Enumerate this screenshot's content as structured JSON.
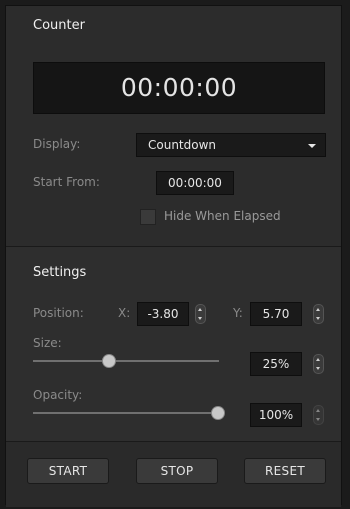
{
  "counter": {
    "title": "Counter",
    "time": "00:00:00",
    "display_label": "Display:",
    "display_value": "Countdown",
    "start_from_label": "Start From:",
    "start_from_value": "00:00:00",
    "hide_when_elapsed_label": "Hide When Elapsed",
    "hide_when_elapsed_checked": false
  },
  "settings": {
    "title": "Settings",
    "position_label": "Position:",
    "x_label": "X:",
    "x_value": "-3.80",
    "y_label": "Y:",
    "y_value": "5.70",
    "size_label": "Size:",
    "size_value": "25%",
    "size_fraction": 0.25,
    "opacity_label": "Opacity:",
    "opacity_value": "100%",
    "opacity_fraction": 1.0
  },
  "controls": {
    "start_label": "START",
    "stop_label": "STOP",
    "reset_label": "RESET"
  },
  "icons": [
    "chevron-down-icon",
    "stepper-arrows-icon",
    "slider-thumb-icon"
  ]
}
